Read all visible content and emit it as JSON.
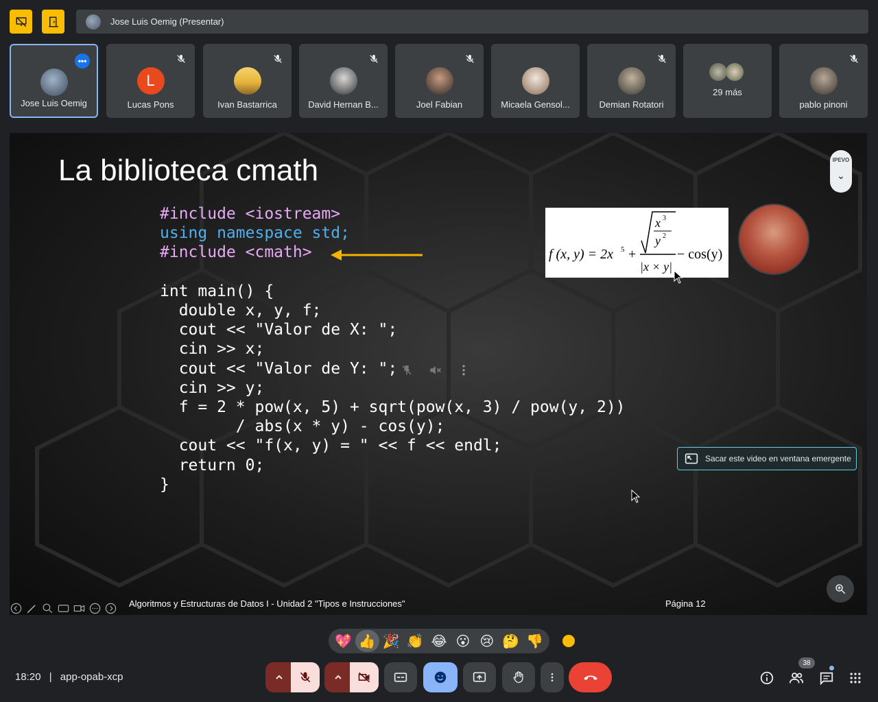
{
  "presenter_bar": {
    "text": "Jose Luis Oemig (Presentar)"
  },
  "participants": [
    {
      "name": "Jose Luis Oemig"
    },
    {
      "name": "Lucas Pons",
      "initial": "L"
    },
    {
      "name": "Ivan Bastarrica"
    },
    {
      "name": "David Hernan B..."
    },
    {
      "name": "Joel Fabian"
    },
    {
      "name": "Micaela Gensol..."
    },
    {
      "name": "Demian Rotatori"
    },
    {
      "name": "29 más"
    },
    {
      "name": "pablo pinoni"
    }
  ],
  "slide": {
    "title": "La biblioteca cmath",
    "footer": "Algoritmos y Estructuras de Datos I - Unidad 2 \"Tipos e Instrucciones\"",
    "page": "Página 12",
    "ipevo_label": "IPEVO",
    "code_lines": [
      "#include <iostream>",
      "using namespace std;",
      "#include <cmath>",
      "",
      "int main() {",
      "  double x, y, f;",
      "  cout << \"Valor de X: \";",
      "  cin >> x;",
      "  cout << \"Valor de Y: \";",
      "  cin >> y;",
      "  f = 2 * pow(x, 5) + sqrt(pow(x, 3) / pow(y, 2))",
      "        / abs(x * y) - cos(y);",
      "  cout << \"f(x, y) = \" << f << endl;",
      "  return 0;",
      "}"
    ],
    "formula": {
      "lhs": "f (x, y) = 2x",
      "exp5": "5",
      "plus": "+",
      "num_x": "x",
      "num_x_exp": "3",
      "den_y": "y",
      "den_y_exp": "2",
      "denominator": "|x × y|",
      "tail": "− cos(y)"
    }
  },
  "popout": {
    "label": "Sacar este video en ventana emergente"
  },
  "reactions": [
    "💖",
    "👍",
    "🎉",
    "👏",
    "😂",
    "😮",
    "😢",
    "🤔",
    "👎"
  ],
  "bottom": {
    "time": "18:20",
    "separator": "|",
    "meeting_code": "app-opab-xcp",
    "people_count": "38"
  },
  "colors": {
    "accent_yellow": "#fbbc04",
    "end_call": "#ea4335",
    "active_border": "#8ab4f8"
  },
  "icons": [
    "presentation-off-icon",
    "door-icon",
    "mic-off-icon",
    "more-icon",
    "camera-off-icon",
    "captions-icon",
    "emoji-icon",
    "present-screen-icon",
    "raise-hand-icon",
    "more-vert-icon",
    "end-call-icon",
    "info-icon",
    "people-icon",
    "chat-icon",
    "apps-icon",
    "zoom-icon",
    "picture-in-picture-icon"
  ]
}
